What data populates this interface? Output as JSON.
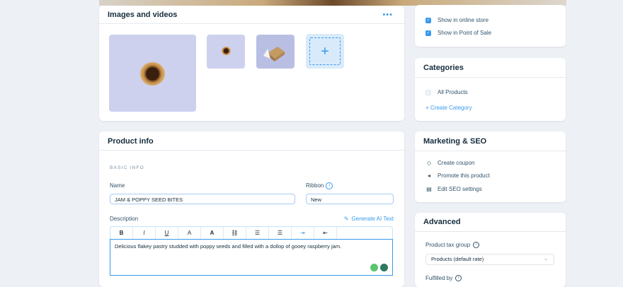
{
  "media": {
    "title": "Images and videos",
    "more_icon": "more-icon",
    "images": [
      "product-image-main",
      "product-image-2",
      "product-image-3"
    ],
    "add_icon": "plus-icon"
  },
  "info": {
    "title": "Product info",
    "section": "BASIC INFO",
    "name_label": "Name",
    "name_value": "JAM & POPPY SEED BITES",
    "ribbon_label": "Ribbon",
    "ribbon_value": "New",
    "description_label": "Description",
    "ai_label": "Generate AI Text",
    "toolbar": [
      "B",
      "I",
      "U",
      "A",
      "A",
      "⛓",
      "☰",
      "☰",
      "⇥",
      "⇤"
    ],
    "description_text": "Delicious flakey pastry studded with poppy seeds and filled with a dollop of gooey raspberry jam."
  },
  "visibility": {
    "online_store": "Show in online store",
    "point_of_sale": "Show in Point of Sale"
  },
  "categories": {
    "title": "Categories",
    "all_products": "All Products",
    "create": "+ Create Category"
  },
  "marketing": {
    "title": "Marketing & SEO",
    "items": [
      "Create coupon",
      "Promote this product",
      "Edit SEO settings"
    ]
  },
  "advanced": {
    "title": "Advanced",
    "tax_label": "Product tax group",
    "tax_value": "Products (default rate)",
    "fulfilled_label": "Fulfilled by"
  },
  "colors": {
    "accent": "#3899ec",
    "background": "#edf0f5",
    "thumb": "#cdd1ee"
  }
}
